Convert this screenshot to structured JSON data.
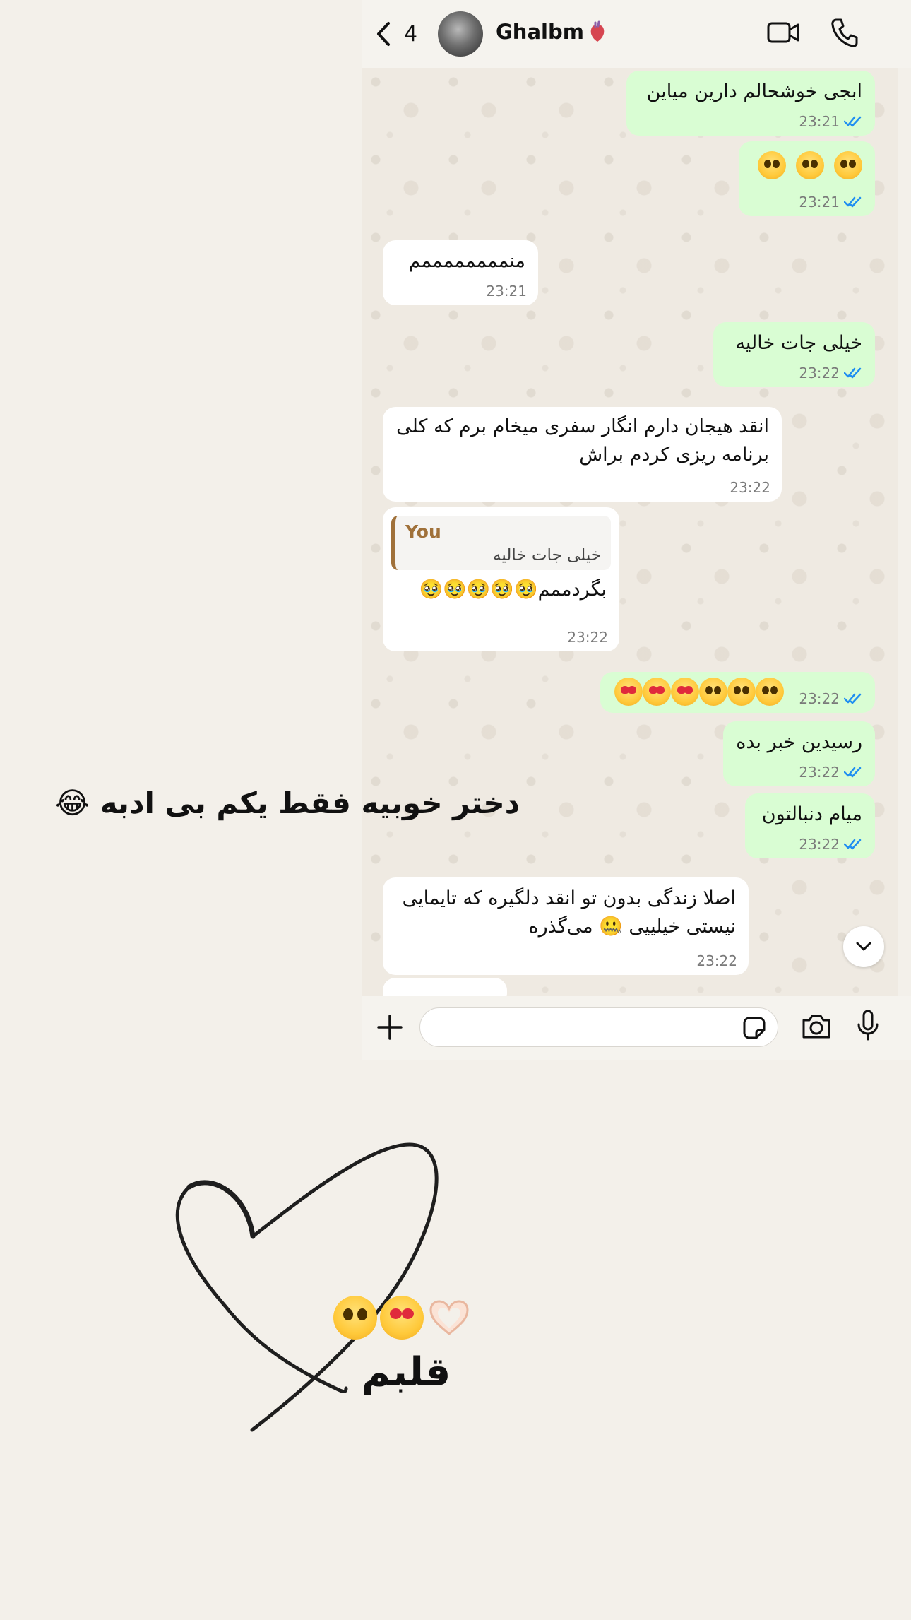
{
  "header": {
    "back_count": "4",
    "contact_name": "Ghalbm",
    "name_emoji": "anatomical-heart"
  },
  "messages": [
    {
      "dir": "out",
      "text": "ابجی خوشحالم دارین میاین",
      "time": "23:21",
      "read": true
    },
    {
      "dir": "out",
      "text": "🥹 🥹 🥹",
      "time": "23:21",
      "read": true
    },
    {
      "dir": "in",
      "text": "منممممممممم",
      "time": "23:21"
    },
    {
      "dir": "out",
      "text": "خیلی جات خالیه",
      "time": "23:22",
      "read": true
    },
    {
      "dir": "in",
      "text": "انقد هیجان دارم انگار سفری میخام برم که کلی برنامه ریزی کردم براش",
      "time": "23:22"
    },
    {
      "dir": "in",
      "quote_author": "You",
      "quote_text": "خیلی جات خالیه",
      "text": "بگردممم🥹🥹🥹🥹🥹",
      "time": "23:22"
    },
    {
      "dir": "out",
      "text": "😍😍😍🥹🥹🥹",
      "time": "23:22",
      "read": true
    },
    {
      "dir": "out",
      "text": "رسیدین خبر بده",
      "time": "23:22",
      "read": true
    },
    {
      "dir": "out",
      "text": "میام دنبالتون",
      "time": "23:22",
      "read": true
    },
    {
      "dir": "in",
      "text": "اصلا زندگی بدون تو انقد دلگیره که تایمایی نیستی خیلییی 🤐 می‌گذره",
      "time": "23:22"
    }
  ],
  "overlay": {
    "caption": "دختر خوبیه فقط یکم بی ادبه 😂",
    "heart_label": "قلبم",
    "emoji_row": [
      "pleading-face",
      "heart-eyes-face",
      "heart-hands"
    ]
  },
  "colors": {
    "outgoing": "#d9fdd3",
    "incoming": "#ffffff",
    "read_ticks": "#1f8ef1",
    "quote_accent": "#a0713a",
    "page_bg": "#f3f0ea"
  }
}
